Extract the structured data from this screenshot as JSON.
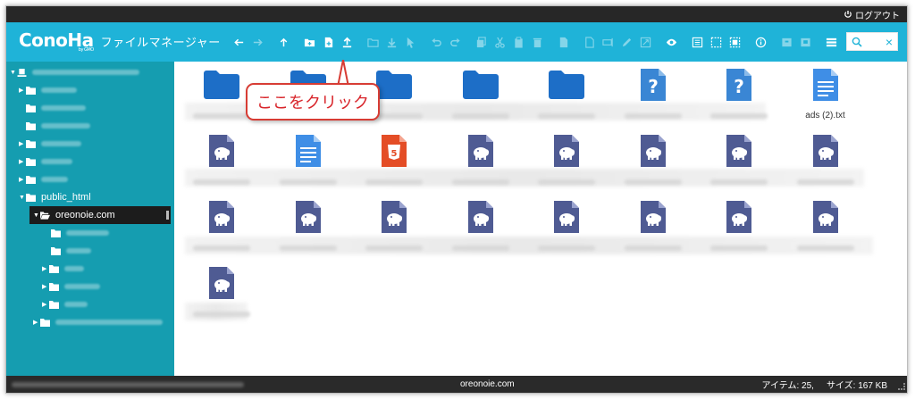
{
  "topbar": {
    "logout_label": "ログアウト"
  },
  "header": {
    "logo": "ConoHa",
    "logo_sub": "by GMO",
    "app_title": "ファイルマネージャー",
    "brand_color": "#1fb3d8"
  },
  "toolbar": {
    "icons": [
      "back-icon",
      "forward-icon",
      "up-icon",
      "new-folder-icon",
      "new-file-icon",
      "upload-icon",
      "open-folder-icon",
      "download-icon",
      "select-icon",
      "undo-icon",
      "redo-icon",
      "copy-icon",
      "cut-icon",
      "paste-icon",
      "delete-icon",
      "duplicate-icon",
      "copy-file-icon",
      "rename-icon",
      "edit-icon",
      "resize-icon",
      "preview-icon",
      "select-all-icon",
      "select-none-icon",
      "invert-select-icon",
      "info-icon",
      "archive-icon",
      "extract-icon",
      "view-list-icon",
      "sort-icon",
      "fullscreen-icon"
    ]
  },
  "search": {
    "placeholder": "",
    "clear": "×"
  },
  "sidebar": {
    "color": "#159db0",
    "items": [
      {
        "label": "public_html"
      },
      {
        "label": "oreonoie.com"
      }
    ]
  },
  "files": [
    {
      "type": "folder",
      "label": ""
    },
    {
      "type": "folder",
      "label": ""
    },
    {
      "type": "folder",
      "label": ""
    },
    {
      "type": "folder",
      "label": ""
    },
    {
      "type": "folder",
      "label": ""
    },
    {
      "type": "unknown",
      "label": ""
    },
    {
      "type": "unknown",
      "label": ""
    },
    {
      "type": "text",
      "label": "ads (2).txt"
    },
    {
      "type": "php",
      "label": ""
    },
    {
      "type": "text",
      "label": ""
    },
    {
      "type": "html",
      "label": ""
    },
    {
      "type": "php",
      "label": ""
    },
    {
      "type": "php",
      "label": ""
    },
    {
      "type": "php",
      "label": ""
    },
    {
      "type": "php",
      "label": ""
    },
    {
      "type": "php",
      "label": ""
    },
    {
      "type": "php",
      "label": ""
    },
    {
      "type": "php",
      "label": ""
    },
    {
      "type": "php",
      "label": ""
    },
    {
      "type": "php",
      "label": ""
    },
    {
      "type": "php",
      "label": ""
    },
    {
      "type": "php",
      "label": ""
    },
    {
      "type": "php",
      "label": ""
    },
    {
      "type": "php",
      "label": ""
    },
    {
      "type": "php",
      "label": ""
    }
  ],
  "callout": {
    "text": "ここをクリック",
    "color": "#d73c34"
  },
  "status": {
    "current_folder": "oreonoie.com",
    "items_label": "アイテム: 25,",
    "size_label": "サイズ: 167 KB"
  }
}
